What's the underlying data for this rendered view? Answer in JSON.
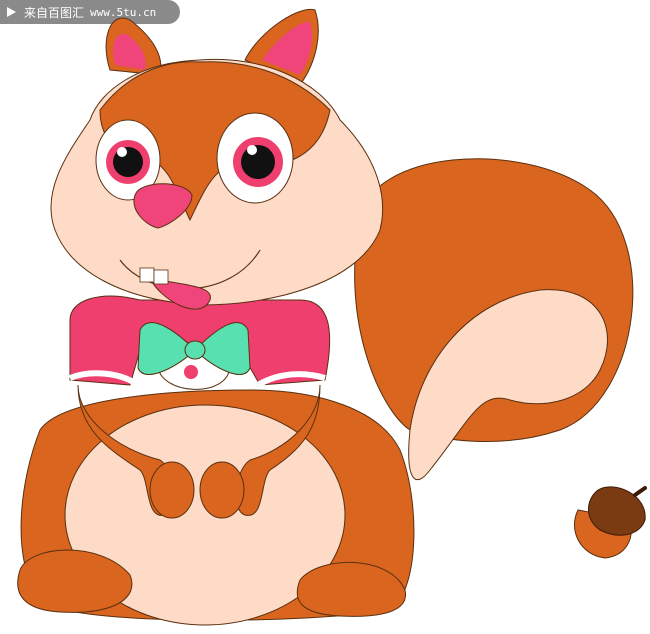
{
  "watermark": {
    "icon": "play-triangle-icon",
    "site_name": "来自百图汇",
    "site_url": "www.5tu.cn"
  },
  "illustration": {
    "subject": "cartoon squirrel with bow tie holding paws, acorn at its side",
    "colors": {
      "fur": "#D9651F",
      "belly": "#FDDBC7",
      "nose": "#F0457A",
      "shirt": "#EF3F6E",
      "bow": "#59E0B0",
      "acorn_cap": "#7A3A12",
      "acorn_body": "#D9651F",
      "outline": "#5A3010"
    }
  }
}
